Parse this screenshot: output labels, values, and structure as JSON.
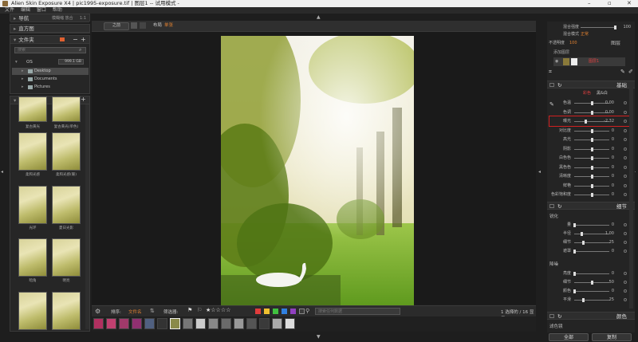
{
  "app": {
    "title": "Alien Skin Exposure X4 | pic1995-exposure.tif | 图层1 -- 试用模式 -",
    "window_controls": {
      "minimize": "–",
      "maximize": "▫",
      "close": "✕"
    }
  },
  "menu": [
    "文件",
    "编辑",
    "窗口",
    "帮助"
  ],
  "left": {
    "nav": {
      "title": "导航",
      "view_mode": "模糊缩 放合",
      "ratio": "1:1"
    },
    "histogram": {
      "title": "直方图"
    },
    "folders": {
      "title": "文件夹",
      "search_placeholder": "搜索",
      "drive": {
        "label": "OS",
        "size": "999.1 GB"
      },
      "items": [
        "Desktop",
        "Documents",
        "Pictures"
      ]
    },
    "presets": {
      "title": "预设",
      "items": [
        "复古黄光",
        "复古黄光(单色)",
        "柔和光感",
        "柔和光感(暖)",
        "光环",
        "夏日光影",
        "暗角",
        "明亮",
        "",
        ""
      ]
    }
  },
  "center": {
    "toolbar": {
      "layers_btn": "之前",
      "overlay_label": "布局",
      "overlay_value": "单张"
    },
    "bottom_bar": {
      "sort_label": "排序:",
      "sort_value": "文件名",
      "filter_label": "筛选器:",
      "stars": "★☆☆☆☆",
      "search_placeholder": "搜索任何数据",
      "count": "1 选择的 / 16 显示",
      "flag_colors": [
        "#e03c3c",
        "#f0c030",
        "#40c040",
        "#3080e0",
        "#9040c0",
        "#3a3a3a"
      ]
    }
  },
  "right": {
    "top": {
      "opacity_label": "混合强度",
      "opacity_value": "100",
      "blend_label": "混合模式",
      "blend_value": "正常",
      "transparency_label": "不透明度",
      "transparency_value": "100",
      "layers_title": "图层",
      "layer_add_label": "添加图层",
      "layer_name": "图层1"
    },
    "basic": {
      "title": "基础",
      "mode_color": "彩色",
      "mode_bw": "黑&白",
      "sliders": [
        {
          "label": "色温",
          "value": "0.00",
          "pos": 0.5
        },
        {
          "label": "色调",
          "value": "0.00",
          "pos": 0.5
        },
        {
          "label": "曝光",
          "value": "-2.32",
          "pos": 0.32
        },
        {
          "label": "对比度",
          "value": "0",
          "pos": 0.5
        },
        {
          "label": "高光",
          "value": "0",
          "pos": 0.5
        },
        {
          "label": "阴影",
          "value": "0",
          "pos": 0.5
        },
        {
          "label": "白色色",
          "value": "0",
          "pos": 0.5
        },
        {
          "label": "黑色色",
          "value": "0",
          "pos": 0.5
        },
        {
          "label": "清晰度",
          "value": "0",
          "pos": 0.5
        },
        {
          "label": "鲜艳",
          "value": "0",
          "pos": 0.5
        },
        {
          "label": "色彩饱和度",
          "value": "0",
          "pos": 0.5
        }
      ]
    },
    "detail": {
      "title": "细节",
      "sharpen_title": "锐化",
      "sharpen": [
        {
          "label": "量",
          "value": "0",
          "pos": 0.0
        },
        {
          "label": "半径",
          "value": "1.00",
          "pos": 0.2
        },
        {
          "label": "细节",
          "value": "25",
          "pos": 0.25
        },
        {
          "label": "遮罩",
          "value": "0",
          "pos": 0.0
        }
      ],
      "noise_title": "降噪",
      "noise": [
        {
          "label": "亮度",
          "value": "0",
          "pos": 0.0
        },
        {
          "label": "细节",
          "value": "50",
          "pos": 0.5
        },
        {
          "label": "颜色",
          "value": "0",
          "pos": 0.0
        },
        {
          "label": "平滑",
          "value": "25",
          "pos": 0.25
        }
      ]
    },
    "color": {
      "title": "颜色",
      "sub": "滤色镜"
    },
    "buttons": {
      "reset": "全部",
      "copy": "复制"
    }
  }
}
